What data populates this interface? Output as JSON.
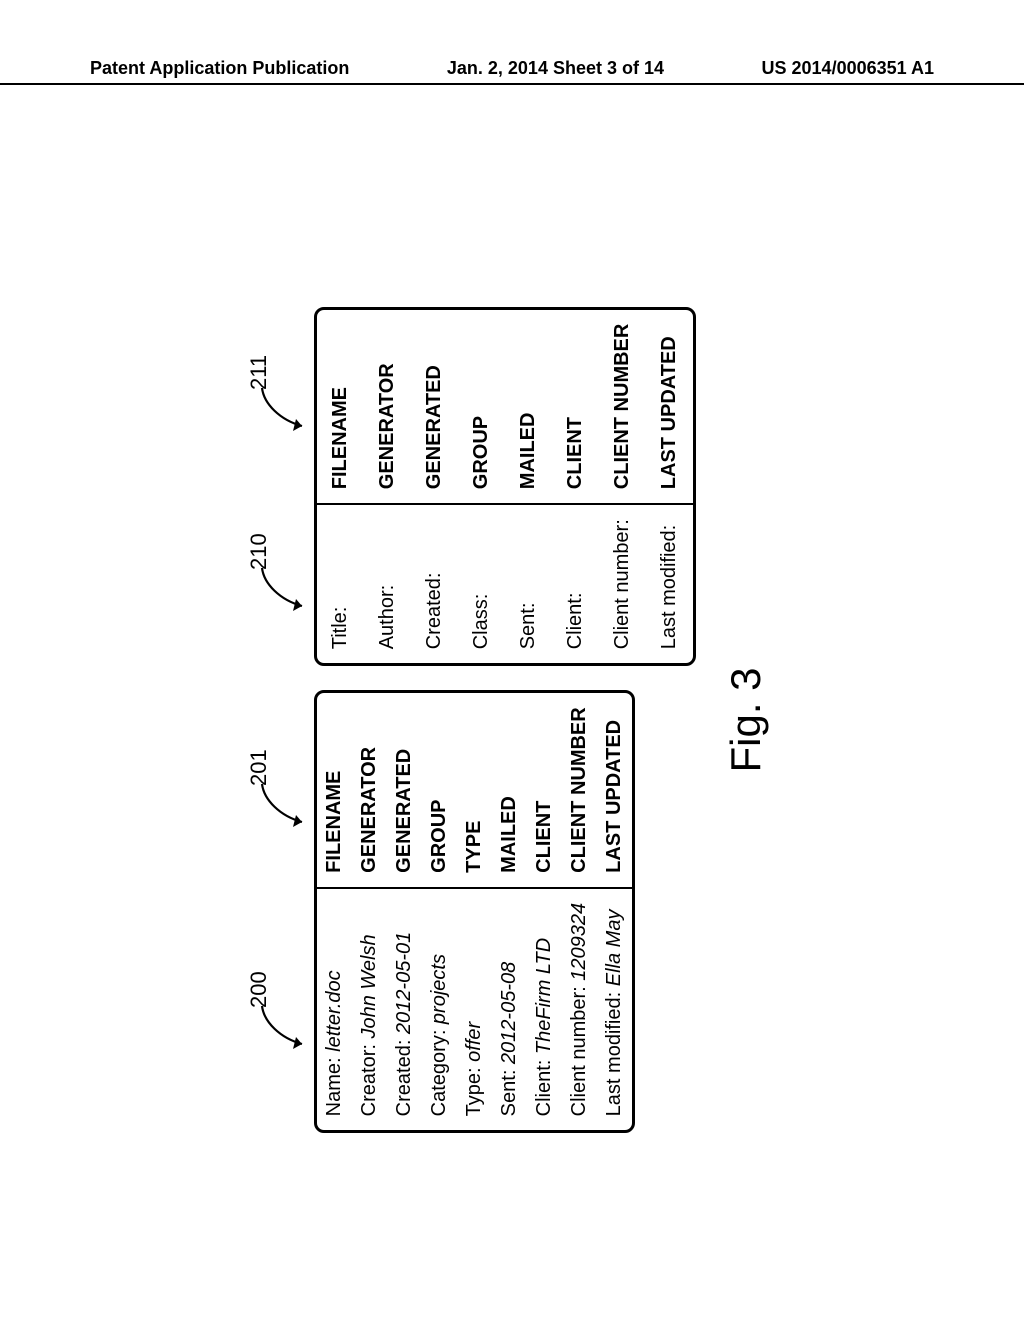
{
  "header": {
    "left": "Patent Application Publication",
    "center": "Jan. 2, 2014   Sheet 3 of 14",
    "right": "US 2014/0006351 A1"
  },
  "refs": {
    "r200": "200",
    "r201": "201",
    "r210": "210",
    "r211": "211"
  },
  "tableA": {
    "rows": [
      {
        "labelPrefix": "Name: ",
        "labelValue": "letter.doc",
        "tag": "FILENAME"
      },
      {
        "labelPrefix": "Creator: ",
        "labelValue": "John Welsh",
        "tag": "GENERATOR"
      },
      {
        "labelPrefix": "Created: ",
        "labelValue": "2012-05-01",
        "tag": "GENERATED"
      },
      {
        "labelPrefix": "Category: ",
        "labelValue": "projects",
        "tag": "GROUP"
      },
      {
        "labelPrefix": "Type: ",
        "labelValue": "offer",
        "tag": "TYPE"
      },
      {
        "labelPrefix": "Sent: ",
        "labelValue": "2012-05-08",
        "tag": "MAILED"
      },
      {
        "labelPrefix": "Client: ",
        "labelValue": "TheFirm LTD",
        "tag": "CLIENT"
      },
      {
        "labelPrefix": "Client number: ",
        "labelValue": "1209324",
        "tag": "CLIENT NUMBER"
      },
      {
        "labelPrefix": "Last modified: ",
        "labelValue": "Ella May",
        "tag": "LAST UPDATED"
      }
    ]
  },
  "tableB": {
    "rows": [
      {
        "label": "Title:",
        "tag": "FILENAME"
      },
      {
        "label": "Author:",
        "tag": "GENERATOR"
      },
      {
        "label": "Created:",
        "tag": "GENERATED"
      },
      {
        "label": "Class:",
        "tag": "GROUP"
      },
      {
        "label": "Sent:",
        "tag": "MAILED"
      },
      {
        "label": "Client:",
        "tag": "CLIENT"
      },
      {
        "label": "Client number:",
        "tag": "CLIENT NUMBER"
      },
      {
        "label": "Last modified:",
        "tag": "LAST UPDATED"
      }
    ]
  },
  "figure_caption": "Fig. 3"
}
